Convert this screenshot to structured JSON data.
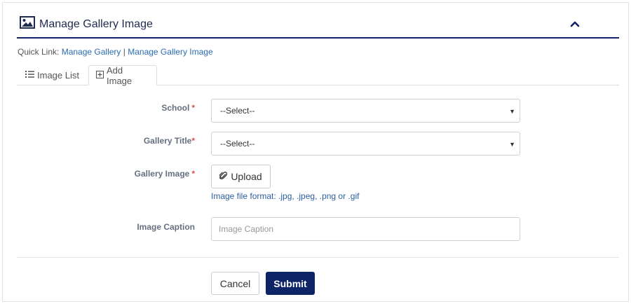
{
  "header": {
    "title": "Manage Gallery Image",
    "title_icon": "image-icon",
    "collapse_icon": "chevron-up-icon",
    "accent_color": "#0d2466"
  },
  "quick_links": {
    "prefix": "Quick Link:",
    "items": [
      "Manage Gallery",
      "Manage Gallery Image"
    ],
    "separator": "|"
  },
  "tabs": [
    {
      "label": "Image List",
      "icon": "list-icon",
      "active": false
    },
    {
      "label": "Add Image",
      "icon": "plus-square-icon",
      "active": true
    }
  ],
  "form": {
    "school": {
      "label": "School",
      "required_mark": "*",
      "value": "--Select--"
    },
    "gallery_title": {
      "label": "Gallery Title",
      "required_mark": "*",
      "value": "--Select--"
    },
    "gallery_image": {
      "label": "Gallery Image",
      "required_mark": "*",
      "button_label": "Upload",
      "button_icon": "paperclip-icon",
      "hint": "Image file format: .jpg, .jpeg, .png or .gif"
    },
    "image_caption": {
      "label": "Image Caption",
      "placeholder": "Image Caption"
    }
  },
  "actions": {
    "cancel_label": "Cancel",
    "submit_label": "Submit"
  }
}
